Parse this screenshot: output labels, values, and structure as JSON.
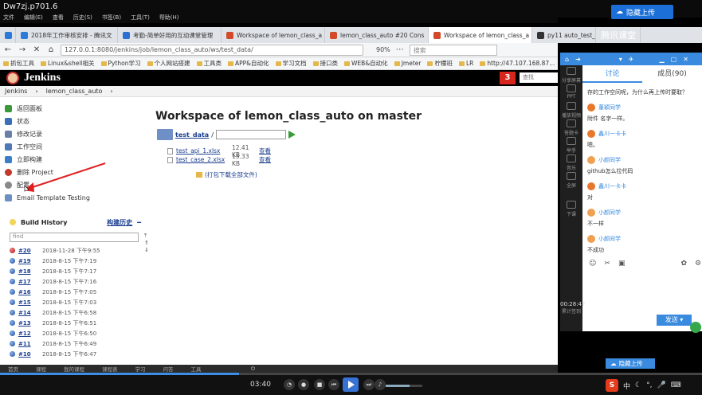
{
  "video": {
    "title": "Dw7zj.p701.6",
    "menu": [
      "文件",
      "编辑(E)",
      "查看",
      "历史(S)",
      "书签(B)",
      "工具(T)",
      "帮助(H)"
    ],
    "cloud_upload": "隐藏上传"
  },
  "tabs": [
    {
      "label": "2018年工作审核安排 - 腾讯文",
      "color": "#2b79d8"
    },
    {
      "label": "考勤-简单好用的互动课堂管理",
      "color": "#2a6fd1"
    },
    {
      "label": "Workspace of lemon_class_a",
      "color": "#d24a2a"
    },
    {
      "label": "lemon_class_auto #20 Cons",
      "color": "#d24a2a"
    },
    {
      "label": "Workspace of lemon_class_a",
      "color": "#d24a2a",
      "active": true
    },
    {
      "label": "py11 auto_test_api",
      "color": "#333333"
    },
    {
      "label": "腾讯课堂",
      "color": "#2a6fd1"
    }
  ],
  "url": {
    "value": "127.0.0.1:8080/jenkins/job/lemon_class_auto/ws/test_data/",
    "zoom": "90%",
    "search_placeholder": "搜索"
  },
  "bookmarks": [
    "抓包工具",
    "Linux&shell相关",
    "Python学习",
    "个人网站搭建",
    "工具类",
    "APP&自动化",
    "学习文档",
    "接口类",
    "WEB&自动化",
    "Jmeter",
    "柠檬班",
    "LR",
    "http://47.107.168.87..."
  ],
  "jenkins": {
    "brand": "Jenkins",
    "badge": "3",
    "search_placeholder": "查找",
    "breadcrumb": [
      "Jenkins",
      "lemon_class_auto"
    ],
    "side_items": [
      {
        "label": "返回面板",
        "color": "#3a9a3a"
      },
      {
        "label": "状态",
        "color": "#3b6fb8"
      },
      {
        "label": "修改记录",
        "color": "#6a7fa8"
      },
      {
        "label": "工作空间",
        "color": "#4f78b8"
      },
      {
        "label": "立即构建",
        "color": "#3a7fc8"
      },
      {
        "label": "删除 Project",
        "color": "#c0392b"
      },
      {
        "label": "配置",
        "color": "#888888"
      },
      {
        "label": "Email Template Testing",
        "color": "#6b8fc2"
      }
    ],
    "build_history": {
      "title": "Build History",
      "trend": "构建历史",
      "trend_suffix": "━",
      "find_placeholder": "find",
      "builds": [
        {
          "num": "#20",
          "time": "2018-11-28 下午9:55",
          "status": "red"
        },
        {
          "num": "#19",
          "time": "2018-8-15 下午7:19",
          "status": "blue"
        },
        {
          "num": "#18",
          "time": "2018-8-15 下午7:17",
          "status": "blue"
        },
        {
          "num": "#17",
          "time": "2018-8-15 下午7:16",
          "status": "blue"
        },
        {
          "num": "#16",
          "time": "2018-8-15 下午7:05",
          "status": "blue"
        },
        {
          "num": "#15",
          "time": "2018-8-15 下午7:03",
          "status": "blue"
        },
        {
          "num": "#14",
          "time": "2018-8-15 下午6:58",
          "status": "blue"
        },
        {
          "num": "#13",
          "time": "2018-8-15 下午6:51",
          "status": "blue"
        },
        {
          "num": "#12",
          "time": "2018-8-15 下午6:50",
          "status": "blue"
        },
        {
          "num": "#11",
          "time": "2018-8-15 下午6:49",
          "status": "blue"
        },
        {
          "num": "#10",
          "time": "2018-8-15 下午6:47",
          "status": "blue"
        }
      ]
    },
    "main": {
      "title": "Workspace of lemon_class_auto on master",
      "folder": "test_data",
      "folder_sep": "/",
      "files": [
        {
          "name": "test_api_1.xlsx",
          "size": "12.41 KB",
          "view": "查看"
        },
        {
          "name": "test_case_2.xlsx",
          "size": "15.33 KB",
          "view": "查看"
        }
      ],
      "zip": "(打包下载全部文件)"
    }
  },
  "bottom_strip": [
    "首页",
    "课程",
    "我的课程",
    "课程表",
    "学习",
    "问答",
    "工具"
  ],
  "player": {
    "time": "03:40",
    "progress": 0.34,
    "volume": 0.65
  },
  "qq": {
    "screen_share": "分享屏幕",
    "tabs": [
      "讨论",
      "成员(90)"
    ],
    "messages": [
      {
        "who": "",
        "text": "存的工作空间呢，为什么再上传时要取？"
      },
      {
        "who": "董颖同学",
        "text": "附件 名字一样。",
        "color": "#e8762b"
      },
      {
        "who": "鑫川一卡卡",
        "text": "嗯。",
        "color": "#e8762b"
      },
      {
        "who": "小颜同学",
        "text": "github怎么拉代码",
        "color": "#f0a050"
      },
      {
        "who": "鑫川一卡卡",
        "text": "对",
        "color": "#e8762b"
      },
      {
        "who": "小颜同学",
        "text": "不一样",
        "color": "#f0a050"
      },
      {
        "who": "小颜同学",
        "text": "不成功",
        "color": "#f0a050"
      }
    ],
    "timer": "00:28:47",
    "timer_label": "累计签到",
    "send": "发送",
    "upload": "隐藏上传",
    "tools": [
      "分享屏幕",
      "PPT",
      "播放视频",
      "答题卡",
      "举手",
      "音乐",
      "全屏",
      "下课"
    ]
  },
  "tray": {
    "ime": "中",
    "ime_brand": "S"
  }
}
